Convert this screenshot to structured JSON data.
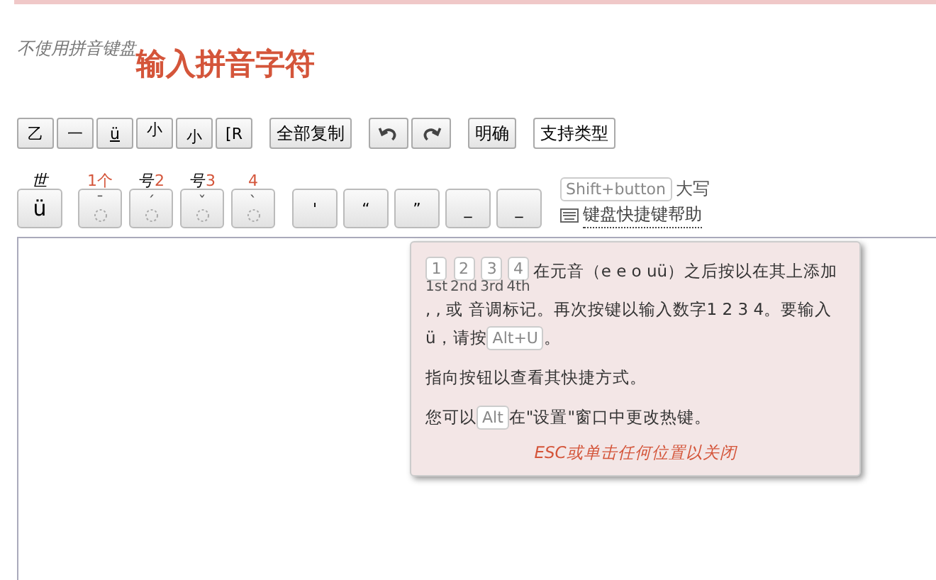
{
  "header": {
    "subtitle": "不使用拼音键盘",
    "title": "输入拼音字符"
  },
  "row1_keys": [
    {
      "label": "乙",
      "kind": "middle",
      "underline": false
    },
    {
      "label": "一",
      "kind": "middle",
      "underline": false
    },
    {
      "label": "ü",
      "kind": "middle",
      "underline": true
    },
    {
      "label": "小",
      "kind": "top",
      "underline": false
    },
    {
      "label": "小",
      "kind": "bottom",
      "underline": false
    },
    {
      "label": "[R",
      "kind": "middle",
      "underline": false
    }
  ],
  "copy_button": "全部复制",
  "history_buttons": [
    {
      "kind": "undo"
    },
    {
      "kind": "redo"
    }
  ],
  "clear_button": "明确",
  "types_button": "支持类型",
  "u_key": {
    "label": "ü",
    "above": [
      {
        "text": "世",
        "kind": "glyph"
      }
    ]
  },
  "tone_keys": [
    {
      "mark": "¯",
      "above": [
        {
          "text": "1个",
          "kind": "number"
        }
      ]
    },
    {
      "mark": "ˊ",
      "above": [
        {
          "text": "号",
          "kind": "glyph"
        },
        {
          "text": "2",
          "kind": "number"
        }
      ]
    },
    {
      "mark": "ˇ",
      "above": [
        {
          "text": "号",
          "kind": "glyph"
        },
        {
          "text": "3",
          "kind": "number"
        }
      ]
    },
    {
      "mark": "ˋ",
      "above": [
        {
          "text": "4",
          "kind": "number"
        }
      ]
    }
  ],
  "punct_keys": [
    "'",
    "“",
    "”",
    "_",
    "_"
  ],
  "shift_hint": {
    "key": "Shift+button",
    "text": "大写"
  },
  "help_link": "键盘快捷键帮助",
  "popup": {
    "paragraphs": [
      [
        {
          "kind": "key",
          "text": "1",
          "note": "1st"
        },
        {
          "kind": "key",
          "text": "2",
          "note": "2nd"
        },
        {
          "kind": "key",
          "text": "3",
          "note": "3rd"
        },
        {
          "kind": "key",
          "text": "4",
          "note": "4th"
        },
        {
          "kind": "text",
          "text": "在元音（e e o uü）之后按以在其上添加 ,  ,  或  音调标记。再次按键以输入数字1 2 3 4。要输入ü，请按"
        },
        {
          "kind": "key",
          "text": "Alt+U"
        },
        {
          "kind": "text",
          "text": "。"
        }
      ],
      [
        {
          "kind": "text",
          "text": "指向按钮以查看其快捷方式。"
        }
      ],
      [
        {
          "kind": "text",
          "text": "您可以"
        },
        {
          "kind": "key",
          "text": "Alt"
        },
        {
          "kind": "text",
          "text": "在\"设置\"窗口中更改热键。"
        }
      ]
    ],
    "footer": "ESC或单击任何位置以关闭"
  }
}
